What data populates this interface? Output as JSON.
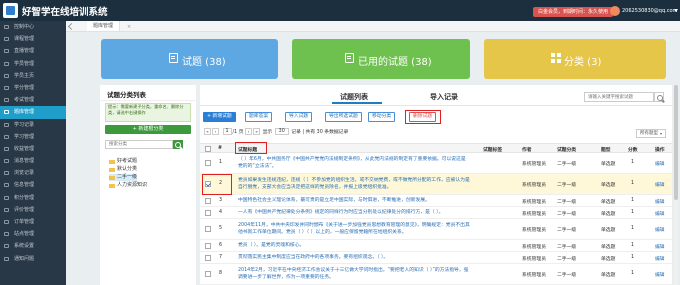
{
  "app": {
    "title": "好智学在线培训系统",
    "license": "白金会员，到期时间：永久使用",
    "user": "2062530830@qq.com"
  },
  "sidebar": {
    "items": [
      {
        "label": "控制中心",
        "active": false
      },
      {
        "label": "课程管理",
        "active": false
      },
      {
        "label": "直播管理",
        "active": false
      },
      {
        "label": "学员管理",
        "active": false
      },
      {
        "label": "学员主页",
        "active": false
      },
      {
        "label": "学分管理",
        "active": false
      },
      {
        "label": "考试管理",
        "active": false
      },
      {
        "label": "题库管理",
        "active": true
      },
      {
        "label": "学习记录",
        "active": false
      },
      {
        "label": "学习管理",
        "active": false
      },
      {
        "label": "收益管理",
        "active": false
      },
      {
        "label": "消息管理",
        "active": false
      },
      {
        "label": "浏览记录",
        "active": false
      },
      {
        "label": "信息管理",
        "active": false
      },
      {
        "label": "积分管理",
        "active": false
      },
      {
        "label": "评价管理",
        "active": false
      },
      {
        "label": "订单管理",
        "active": false
      },
      {
        "label": "站点管理",
        "active": false
      },
      {
        "label": "系统设置",
        "active": false
      },
      {
        "label": "通知问题",
        "active": false
      }
    ]
  },
  "page_tab": {
    "label": "题库管理",
    "close": "×"
  },
  "stats": {
    "questions": "试题 (38)",
    "used": "已用的试题 (38)",
    "categories": "分类 (3)"
  },
  "left_panel": {
    "title": "试题分类列表",
    "tip": "提示：需要新建子分类，重命名、删除分类，请选中右键操作",
    "new_button": "+ 新建根分类",
    "search_placeholder": "搜索分类",
    "tree": [
      "好考试题",
      "默认分类",
      "二手一级",
      "人力资源知识"
    ]
  },
  "main": {
    "tabs": [
      "试题列表",
      "导入记录"
    ],
    "search_placeholder": "请输入关键字搜索试题",
    "toolbar": {
      "add": "+ 新增试题",
      "import_excel": "题库答案",
      "import_q": "导入试题",
      "export": "导出所选试题",
      "move": "移动分类",
      "delete": "删除试题"
    },
    "pager": {
      "first": "«",
      "prev": "‹",
      "page": "1",
      "total_pages": "/1 页",
      "next": "›",
      "last": "»",
      "label_per": "显示",
      "per_page": "30",
      "summary": "记录 | 共有 30 条数据记录"
    },
    "type_filter": "所有题型",
    "columns": [
      "#",
      "试题标题",
      "试题标签",
      "作者",
      "试题分类",
      "题型",
      "分数",
      "操作"
    ],
    "rows": [
      {
        "num": "1",
        "title": "（  ）年6月，中共国务厅《中国共产党党内法规制定条例》，从此党内法规的制定有了重要依据。可以说这是党的的“立法法”。",
        "tag": "",
        "author": "系统管理员",
        "category": "二手一级",
        "type": "单选题",
        "score": "1",
        "op": "编辑",
        "checked": false
      },
      {
        "num": "2",
        "title": "党员如果发生违规违纪，违规（  ）不参加党的组织生活，或不交纳党费，或不做党所分配的工作，应被认为是自行脱党，支部大会应当决定把这样的党员除名，并报上级党组织批准。",
        "tag": "",
        "author": "系统管理员",
        "category": "二手一级",
        "type": "单选题",
        "score": "1",
        "op": "编辑",
        "checked": true
      },
      {
        "num": "3",
        "title": "中国特色社会主义理论体系，最可贵的是立足中国实际，与时俱进，不断推进，创新发展。",
        "tag": "",
        "author": "系统管理员",
        "category": "二手一级",
        "type": "单选题",
        "score": "1",
        "op": "编辑",
        "checked": false
      },
      {
        "num": "4",
        "title": "一人有《中国共产党纪律处分条例》规定的同样行为时应当分别处以纪律处分的排行方，是（  ）。",
        "tag": "",
        "author": "系统管理员",
        "category": "二手一级",
        "type": "单选题",
        "score": "1",
        "op": "编辑",
        "checked": false
      },
      {
        "num": "5",
        "title": "2004年11月，中共中央印发并同时颁布《关于进一步加强党员思想教育管理的意见》，明确规定：党员不出其他书就工作单位期间。党员（  ）（  ）以上的，一般应保留党籍所在地组织关系。",
        "tag": "",
        "author": "系统管理员",
        "category": "二手一级",
        "type": "单选题",
        "score": "1",
        "op": "编辑",
        "checked": false
      },
      {
        "num": "6",
        "title": "党员（  ）。是党的灵魂和核心。",
        "tag": "",
        "author": "系统管理员",
        "category": "二手一级",
        "type": "单选题",
        "score": "1",
        "op": "编辑",
        "checked": false
      },
      {
        "num": "7",
        "title": "贯彻落实民主集中制度应当在政府中的各项事务。要有组织观念。（  ）。",
        "tag": "",
        "author": "系统管理员",
        "category": "二手一级",
        "type": "单选题",
        "score": "1",
        "op": "编辑",
        "checked": false
      },
      {
        "num": "8",
        "title": "2014年2月，习近平在中央经济工作会议关于十三亿做大学问时指出，“要把老人的知识（  ）”的方法指导，强调要进一步了解世界，作为一项重要的任务。",
        "tag": "",
        "author": "系统管理员",
        "category": "二手一级",
        "type": "单选题",
        "score": "1",
        "op": "编辑",
        "checked": false
      }
    ]
  },
  "colors": {
    "stat_blue": "#5da8e2",
    "stat_green": "#6fc14f",
    "stat_yellow": "#e6c649",
    "sidebar_bg": "#283846",
    "sidebar_active": "#1f9ec9",
    "topbar_bg": "#1c2f3e",
    "highlight_red": "#e02020"
  }
}
